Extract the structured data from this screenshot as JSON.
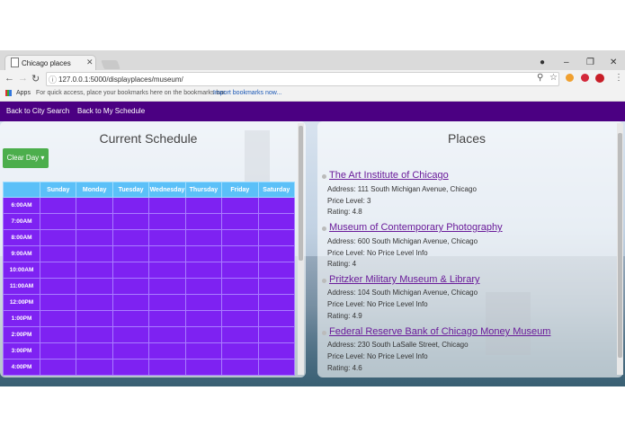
{
  "browser": {
    "tab_title": "Chicago places",
    "url": "127.0.0.1:5000/displayplaces/museum/",
    "bookmarks_apps": "Apps",
    "bookmarks_hint": "For quick access, place your bookmarks here on the bookmarks bar.",
    "bookmarks_import": "Import bookmarks now..."
  },
  "nav": {
    "back_city": "Back to City Search",
    "back_schedule": "Back to My Schedule"
  },
  "schedule": {
    "title": "Current Schedule",
    "clear_label": "Clear Day ▾",
    "days": [
      "Sunday",
      "Monday",
      "Tuesday",
      "Wednesday",
      "Thursday",
      "Friday",
      "Saturday"
    ],
    "times": [
      "6:00AM",
      "7:00AM",
      "8:00AM",
      "9:00AM",
      "10:00AM",
      "11:00AM",
      "12:00PM",
      "1:00PM",
      "2:00PM",
      "3:00PM",
      "4:00PM"
    ]
  },
  "places": {
    "title": "Places",
    "items": [
      {
        "name": "The Art Institute of Chicago",
        "address": "Address: 111 South Michigan Avenue, Chicago",
        "price": "Price Level: 3",
        "rating": "Rating: 4.8"
      },
      {
        "name": "Museum of Contemporary Photography",
        "address": "Address: 600 South Michigan Avenue, Chicago",
        "price": "Price Level: No Price Level Info",
        "rating": "Rating: 4"
      },
      {
        "name": "Pritzker Military Museum & Library",
        "address": "Address: 104 South Michigan Avenue, Chicago",
        "price": "Price Level: No Price Level Info",
        "rating": "Rating: 4.9"
      },
      {
        "name": "Federal Reserve Bank of Chicago Money Museum",
        "address": "Address: 230 South LaSalle Street, Chicago",
        "price": "Price Level: No Price Level Info",
        "rating": "Rating: 4.6"
      }
    ]
  },
  "colors": {
    "navbar": "#4b0082",
    "grid_header": "#5bc0f8",
    "grid_cell": "#7e22f2",
    "clear_button": "#4cae4c",
    "link": "#6a1b9a"
  }
}
